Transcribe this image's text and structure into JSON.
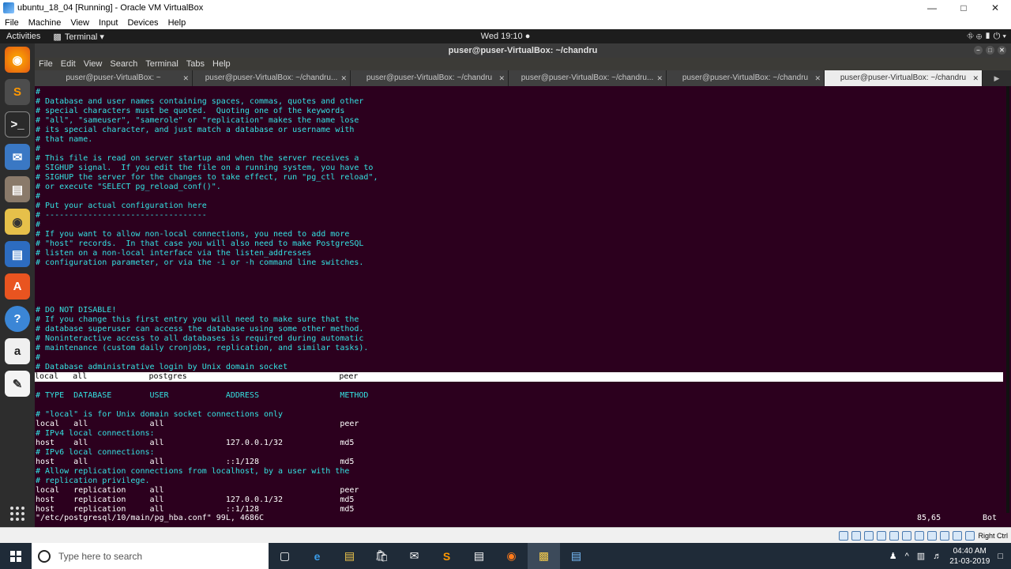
{
  "vbox": {
    "title": "ubuntu_18_04 [Running] - Oracle VM VirtualBox",
    "menus": [
      "File",
      "Machine",
      "View",
      "Input",
      "Devices",
      "Help"
    ],
    "status_host_key": "Right Ctrl"
  },
  "gnome": {
    "activities": "Activities",
    "app_menu": "Terminal ▾",
    "clock": "Wed 19:10 ●",
    "tray": "⛗ ⊕ ▮ ⏻ ▾"
  },
  "terminal": {
    "title": "puser@puser-VirtualBox: ~/chandru",
    "menus": [
      "File",
      "Edit",
      "View",
      "Search",
      "Terminal",
      "Tabs",
      "Help"
    ],
    "tabs": [
      "puser@puser-VirtualBox: ~",
      "puser@puser-VirtualBox: ~/chandru...",
      "puser@puser-VirtualBox: ~/chandru",
      "puser@puser-VirtualBox: ~/chandru...",
      "puser@puser-VirtualBox: ~/chandru",
      "puser@puser-VirtualBox: ~/chandru"
    ],
    "lines": [
      {
        "t": "#",
        "c": true
      },
      {
        "t": "# Database and user names containing spaces, commas, quotes and other",
        "c": true
      },
      {
        "t": "# special characters must be quoted.  Quoting one of the keywords",
        "c": true
      },
      {
        "t": "# \"all\", \"sameuser\", \"samerole\" or \"replication\" makes the name lose",
        "c": true
      },
      {
        "t": "# its special character, and just match a database or username with",
        "c": true
      },
      {
        "t": "# that name.",
        "c": true
      },
      {
        "t": "#",
        "c": true
      },
      {
        "t": "# This file is read on server startup and when the server receives a",
        "c": true
      },
      {
        "t": "# SIGHUP signal.  If you edit the file on a running system, you have to",
        "c": true
      },
      {
        "t": "# SIGHUP the server for the changes to take effect, run \"pg_ctl reload\",",
        "c": true
      },
      {
        "t": "# or execute \"SELECT pg_reload_conf()\".",
        "c": true
      },
      {
        "t": "#",
        "c": true
      },
      {
        "t": "# Put your actual configuration here",
        "c": true
      },
      {
        "t": "# ----------------------------------",
        "c": true
      },
      {
        "t": "#",
        "c": true
      },
      {
        "t": "# If you want to allow non-local connections, you need to add more",
        "c": true
      },
      {
        "t": "# \"host\" records.  In that case you will also need to make PostgreSQL",
        "c": true
      },
      {
        "t": "# listen on a non-local interface via the listen_addresses",
        "c": true
      },
      {
        "t": "# configuration parameter, or via the -i or -h command line switches.",
        "c": true
      },
      {
        "t": "",
        "c": false
      },
      {
        "t": "",
        "c": false
      },
      {
        "t": "",
        "c": false
      },
      {
        "t": "",
        "c": false
      },
      {
        "t": "# DO NOT DISABLE!",
        "c": true
      },
      {
        "t": "# If you change this first entry you will need to make sure that the",
        "c": true
      },
      {
        "t": "# database superuser can access the database using some other method.",
        "c": true
      },
      {
        "t": "# Noninteractive access to all databases is required during automatic",
        "c": true
      },
      {
        "t": "# maintenance (custom daily cronjobs, replication, and similar tasks).",
        "c": true
      },
      {
        "t": "#",
        "c": true
      },
      {
        "t": "# Database administrative login by Unix domain socket",
        "c": true
      },
      {
        "t": "local   all             postgres                                peer",
        "c": false,
        "hl": true
      },
      {
        "t": "",
        "c": false
      },
      {
        "t": "# TYPE  DATABASE        USER            ADDRESS                 METHOD",
        "c": true
      },
      {
        "t": "",
        "c": false
      },
      {
        "t": "# \"local\" is for Unix domain socket connections only",
        "c": true
      },
      {
        "t": "local   all             all                                     peer",
        "c": false
      },
      {
        "t": "# IPv4 local connections:",
        "c": true
      },
      {
        "t": "host    all             all             127.0.0.1/32            md5",
        "c": false
      },
      {
        "t": "# IPv6 local connections:",
        "c": true
      },
      {
        "t": "host    all             all             ::1/128                 md5",
        "c": false
      },
      {
        "t": "# Allow replication connections from localhost, by a user with the",
        "c": true
      },
      {
        "t": "# replication privilege.",
        "c": true
      },
      {
        "t": "local   replication     all                                     peer",
        "c": false
      },
      {
        "t": "host    replication     all             127.0.0.1/32            md5",
        "c": false
      },
      {
        "t": "host    replication     all             ::1/128                 md5",
        "c": false
      }
    ],
    "status_file": "\"/etc/postgresql/10/main/pg_hba.conf\" 99L, 4686C",
    "status_pos": "85,65",
    "status_scroll": "Bot"
  },
  "taskbar": {
    "search_placeholder": "Type here to search",
    "time": "04:40 AM",
    "date": "21-03-2019"
  }
}
